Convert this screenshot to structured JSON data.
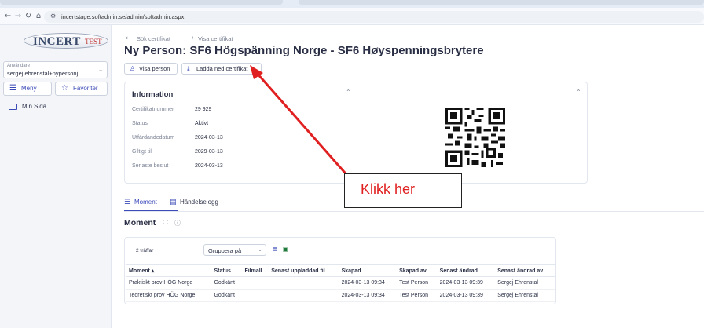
{
  "browser": {
    "url": "incertstage.softadmin.se/admin/softadmin.aspx",
    "back_icon": "arrow-left-icon",
    "forward_icon": "arrow-right-icon",
    "reload_icon": "reload-icon",
    "home_icon": "home-icon"
  },
  "sidebar": {
    "logo_main": "INCERT",
    "logo_badge": "TEST",
    "user_caption": "Användare",
    "user_value": "sergej.ehrenstal+nypersonj...",
    "menu_label": "Meny",
    "favorites_label": "Favoriter",
    "items": [
      {
        "label": "Min Sida",
        "icon": "monitor-icon"
      }
    ]
  },
  "breadcrumb": {
    "crumb1": "Sök certifikat",
    "separator": "/",
    "crumb2": "Visa certifikat"
  },
  "page_title": "Ny Person: SF6 Högspänning Norge - SF6 Høyspenningsbrytere",
  "actions": {
    "view_person": "Visa person",
    "download_cert": "Ladda ned certifikat"
  },
  "info": {
    "title": "Information",
    "rows": [
      {
        "k": "Certifikatnummer",
        "v": "29 929"
      },
      {
        "k": "Status",
        "v": "Aktivt"
      },
      {
        "k": "Utfärdandedatum",
        "v": "2024-03-13"
      },
      {
        "k": "Giltigt till",
        "v": "2029-03-13"
      },
      {
        "k": "Senaste beslut",
        "v": "2024-03-13"
      }
    ]
  },
  "tabs": [
    {
      "label": "Moment",
      "icon": "list-icon",
      "active": true
    },
    {
      "label": "Händelselogg",
      "icon": "log-icon",
      "active": false
    }
  ],
  "moment": {
    "heading": "Moment",
    "hits": "2 träffar",
    "group_by": "Gruppera på",
    "columns": [
      "Moment ▴",
      "Status",
      "Filmall",
      "Senast uppladdad fil",
      "Skapad",
      "Skapad av",
      "Senast ändrad",
      "Senast ändrad av"
    ],
    "rows": [
      [
        "Praktiskt prov HÖG Norge",
        "Godkänt",
        "",
        "",
        "2024-03-13 09:34",
        "Test Person",
        "2024-03-13 09:39",
        "Sergej Ehrenstal"
      ],
      [
        "Teoretiskt prov HÖG Norge",
        "Godkänt",
        "",
        "",
        "2024-03-13 09:34",
        "Test Person",
        "2024-03-13 09:39",
        "Sergej Ehrenstal"
      ]
    ]
  },
  "annotation": {
    "text": "Klikk her",
    "color": "#e02020"
  },
  "colors": {
    "accent": "#3b4bb8",
    "excel_green": "#1e7a3a"
  }
}
